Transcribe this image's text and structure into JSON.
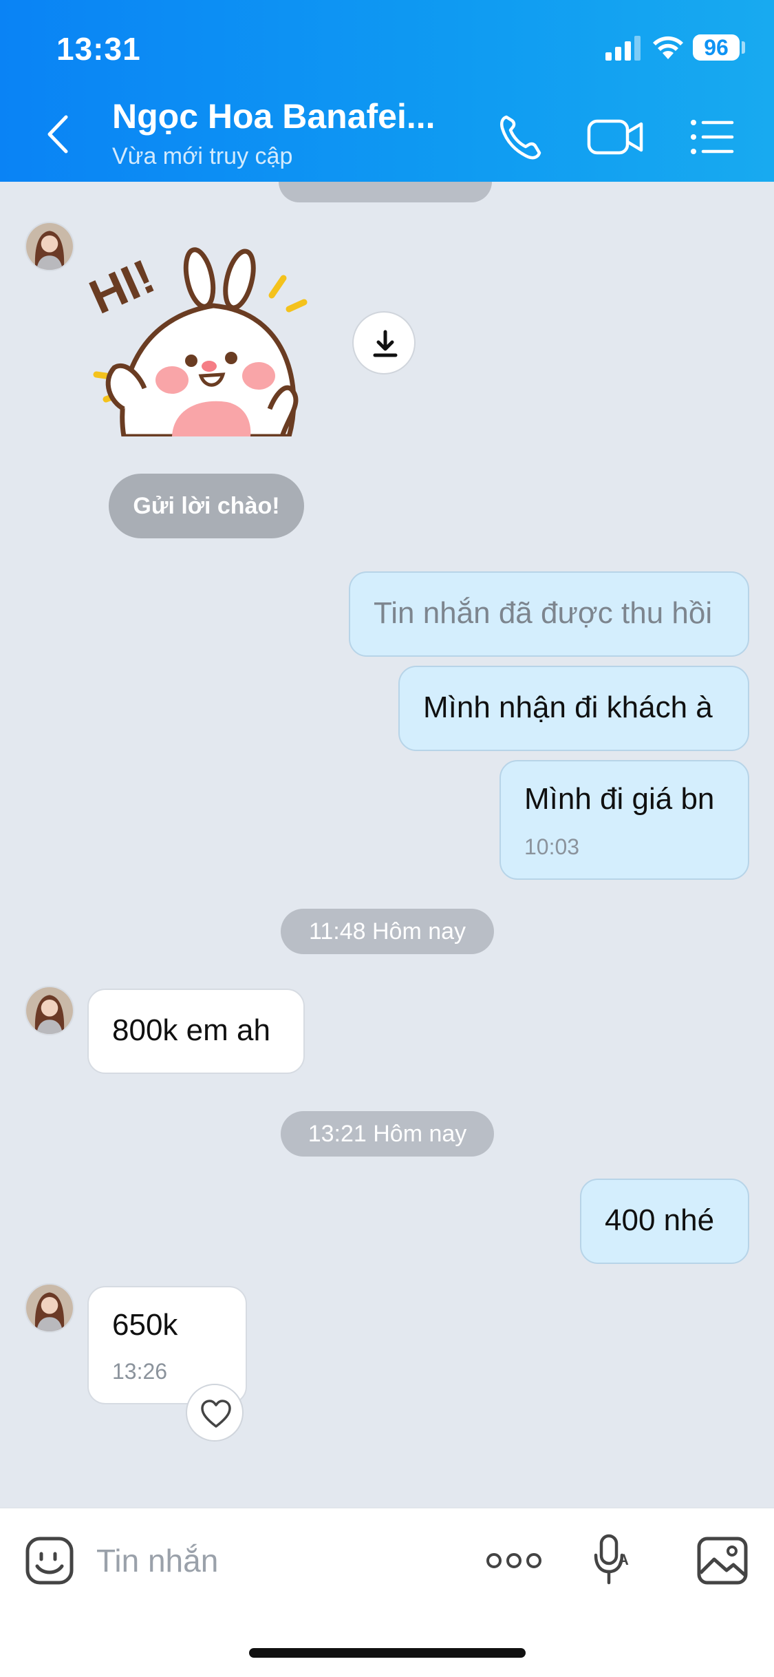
{
  "status_bar": {
    "time": "13:31",
    "battery": "96"
  },
  "header": {
    "contact_name": "Ngọc Hoa Banafei...",
    "contact_status": "Vừa mới truy cập"
  },
  "greeting_chip": "Gửi lời chào!",
  "messages": [
    {
      "direction": "out",
      "text": "Tin nhắn đã được thu hồi",
      "recalled": true
    },
    {
      "direction": "out",
      "text": "Mình nhận đi khách à"
    },
    {
      "direction": "out",
      "text": "Mình đi giá bn",
      "time": "10:03"
    },
    {
      "direction": "in",
      "text": "800k em ah"
    },
    {
      "direction": "out",
      "text": "400 nhé"
    },
    {
      "direction": "in",
      "text": "650k",
      "time": "13:26"
    }
  ],
  "time_separators": [
    "11:48 Hôm nay",
    "13:21 Hôm nay"
  ],
  "composer": {
    "placeholder": "Tin nhắn"
  },
  "colors": {
    "header": "#0a83f5",
    "outgoing_bubble": "#d4eefd",
    "incoming_bubble": "#ffffff",
    "chat_bg": "#e3e8ef"
  },
  "icons": [
    "back-icon",
    "phone-icon",
    "video-icon",
    "list-menu-icon",
    "download-icon",
    "heart-icon",
    "emoji-icon",
    "more-icon",
    "voice-icon",
    "image-icon"
  ]
}
